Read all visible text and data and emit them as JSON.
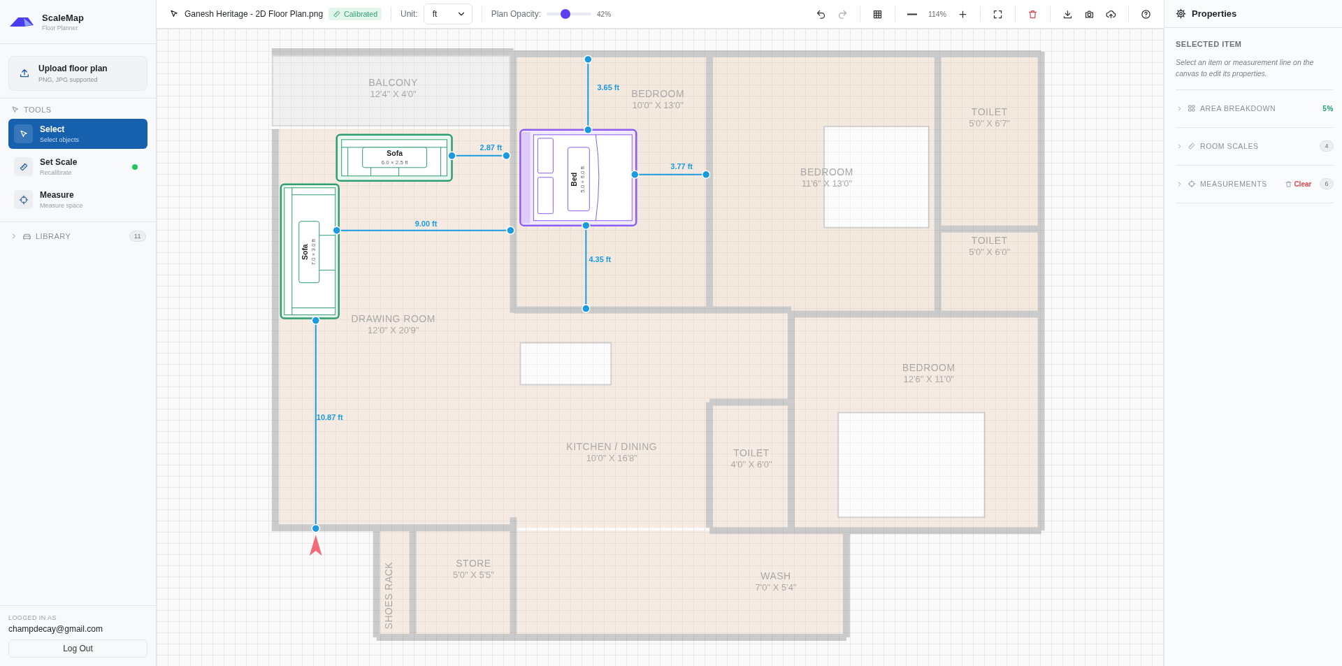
{
  "sidebar": {
    "app_name": "ScaleMap",
    "app_subtitle": "Floor Planner",
    "upload": {
      "title": "Upload floor plan",
      "hint": "PNG, JPG supported"
    },
    "tools_heading": "TOOLS",
    "tools": [
      {
        "kind": "select",
        "label": "Select",
        "hint": "Select objects",
        "selected": true,
        "status_dot": false
      },
      {
        "kind": "scale",
        "label": "Set Scale",
        "hint": "Recalibrate",
        "selected": false,
        "status_dot": true
      },
      {
        "kind": "measure",
        "label": "Measure",
        "hint": "Measure space",
        "selected": false,
        "status_dot": false
      }
    ],
    "library": {
      "label": "LIBRARY",
      "count": "11",
      "expanded": false
    },
    "account": {
      "caption": "LOGGED IN AS",
      "email": "champdecay@gmail.com",
      "logout": "Log Out"
    }
  },
  "toolbar": {
    "file_name": "Ganesh Heritage - 2D Floor Plan.png",
    "badge": "Calibrated",
    "unit_label": "Unit:",
    "unit": "ft",
    "opacity_label": "Plan Opacity:",
    "opacity": {
      "level": 0.42
    },
    "opacity_reading": "42%",
    "zoom": "114%"
  },
  "plan": {
    "rooms": [
      {
        "name": "BALCONY",
        "size": "12'4\" X 4'0\""
      },
      {
        "name": "BEDROOM",
        "size": "10'0\" X 13'0\""
      },
      {
        "name": "TOILET",
        "size": "5'0\" X 6'7\""
      },
      {
        "name": "BEDROOM",
        "size": "11'6\" X 13'0\""
      },
      {
        "name": "TOILET",
        "size": "5'0\" X 6'0\""
      },
      {
        "name": "DRAWING ROOM",
        "size": "12'0\" X 20'9\""
      },
      {
        "name": "BEDROOM",
        "size": "12'6\" X 11'0\""
      },
      {
        "name": "KITCHEN / DINING",
        "size": "10'0\" X 16'8\""
      },
      {
        "name": "TOILET",
        "size": "4'0\" X 6'0\""
      },
      {
        "name": "STORE",
        "size": "5'0\" X 5'5\""
      },
      {
        "name": "WASH",
        "size": "7'0\" X 5'4\""
      },
      {
        "name": "SHOES RACK"
      }
    ]
  },
  "furniture": [
    {
      "kind": "sofa",
      "name": "Sofa",
      "size": "6.0 × 2.5 ft",
      "color": "#2f9e6e"
    },
    {
      "kind": "sofa_vertical",
      "name": "Sofa",
      "size": "7.0 × 3.0 ft",
      "color": "#2f9e6e"
    },
    {
      "kind": "bed",
      "name": "Bed",
      "size": "5.0 × 6.0 ft",
      "color": "#8b5cf6"
    }
  ],
  "measurements": [
    {
      "label": "3.65 ft"
    },
    {
      "label": "2.87 ft"
    },
    {
      "label": "3.77 ft"
    },
    {
      "label": "9.00 ft"
    },
    {
      "label": "4.35 ft"
    },
    {
      "label": "10.87 ft"
    }
  ],
  "properties": {
    "title": "Properties",
    "section": "SELECTED ITEM",
    "hint": "Select an item or measurement line on the canvas to edit its properties.",
    "panels": [
      {
        "kind": "area",
        "label": "AREA BREAKDOWN",
        "value": "5%",
        "expanded": false
      },
      {
        "kind": "scales",
        "label": "ROOM SCALES",
        "count": "4",
        "expanded": false
      },
      {
        "kind": "measurements",
        "label": "MEASUREMENTS",
        "action": "Clear",
        "count": "6",
        "expanded": false
      }
    ]
  }
}
